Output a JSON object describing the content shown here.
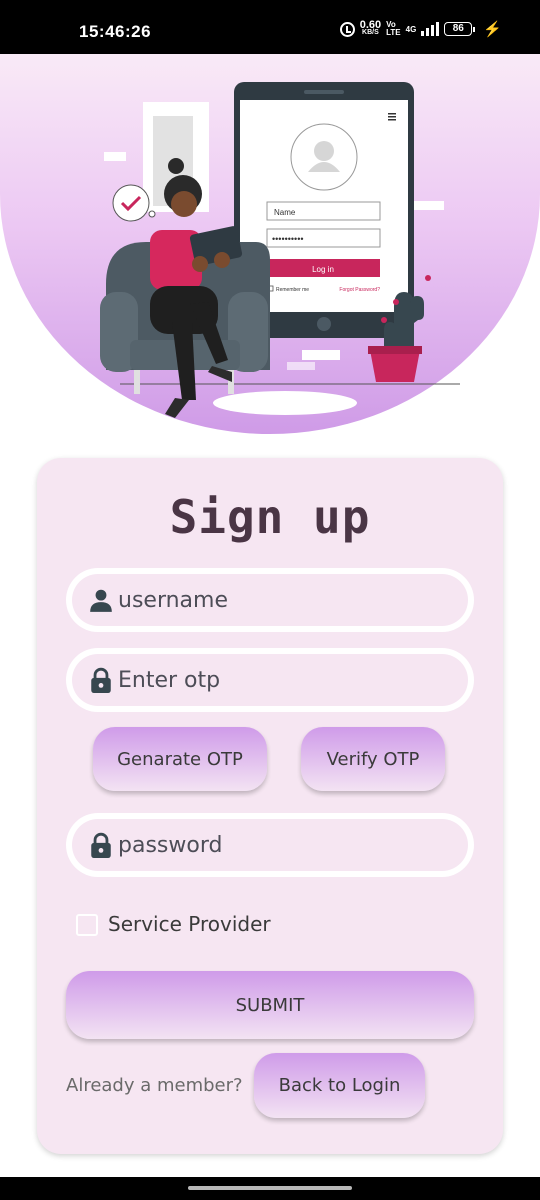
{
  "status_bar": {
    "time": "15:46:26",
    "net_speed_value": "0.60",
    "net_speed_unit": "KB/S",
    "volte_top": "Vo",
    "volte_bottom": "LTE",
    "network_type": "4G",
    "battery_level": "86"
  },
  "illustration": {
    "name_field_label": "Name",
    "password_dots": "••••••••••",
    "login_button_label": "Log in",
    "remember_me_label": "Remember me",
    "forgot_password_label": "Forgot Password?"
  },
  "form": {
    "title": "Sign up",
    "username_placeholder": "username",
    "otp_placeholder": "Enter otp",
    "generate_otp_label": "Genarate OTP",
    "verify_otp_label": "Verify OTP",
    "password_placeholder": "password",
    "service_provider_label": "Service Provider",
    "service_provider_checked": false,
    "submit_label": "SUBMIT",
    "already_member_text": "Already a member?",
    "back_to_login_label": "Back to Login"
  },
  "colors": {
    "accent_purple": "#cf9be9",
    "card_background": "#f6e6f2",
    "title_color": "#4a3545",
    "icon_color": "#37474f",
    "illustration_pink": "#c8265c"
  },
  "icons": {
    "username": "person-icon",
    "otp": "lock-icon",
    "password": "lock-icon"
  }
}
